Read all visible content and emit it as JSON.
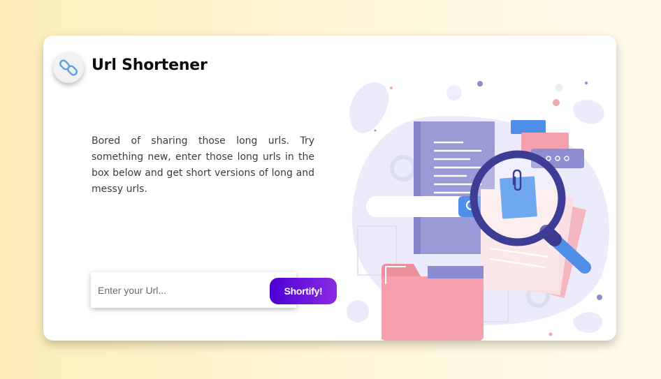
{
  "app": {
    "title": "Url Shortener",
    "logo_icon": "link-icon"
  },
  "main": {
    "description": "Bored of sharing those long urls. Try something new, enter those long urls in the box below and get short versions of long and messy urls."
  },
  "form": {
    "input_value": "",
    "input_placeholder": "Enter your Url...",
    "button_label": "Shortify!"
  },
  "illustration": {
    "icons": [
      "search-icon",
      "magnifier-icon",
      "document-icon",
      "folder-icon",
      "paperclip-icon",
      "gear-icon"
    ]
  },
  "colors": {
    "accent_start": "#4c00d6",
    "accent_end": "#8a2be2",
    "link_icon": "#5aa0e6",
    "background": "#fdeeb9"
  }
}
